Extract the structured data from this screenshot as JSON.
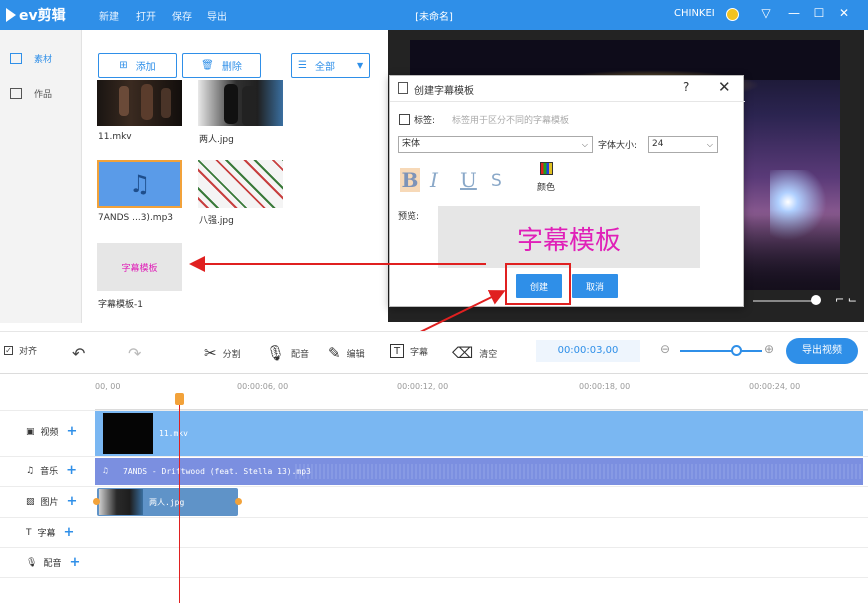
{
  "app": {
    "logo_text": "ev剪辑",
    "menu": [
      "新建",
      "打开",
      "保存",
      "导出"
    ],
    "window_title": "[未命名]",
    "username": "CHINKEI"
  },
  "leftnav": {
    "items": [
      {
        "label": "素材",
        "active": true
      },
      {
        "label": "作品",
        "active": false
      }
    ]
  },
  "materials": {
    "add_label": "添加",
    "delete_label": "删除",
    "filter_label": "全部",
    "items": [
      {
        "name": "11.mkv"
      },
      {
        "name": "两人.jpg"
      },
      {
        "name": "7ANDS ...3).mp3"
      },
      {
        "name": "八强.jpg"
      },
      {
        "name": "字幕模板-1",
        "thumb_text": "字幕模板"
      }
    ]
  },
  "dialog": {
    "title": "创建字幕模板",
    "help": "?",
    "close": "✕",
    "tag_label": "标签:",
    "tag_placeholder": "标签用于区分不同的字幕模板",
    "font_value": "宋体",
    "size_label": "字体大小:",
    "size_value": "24",
    "format_buttons": [
      "B",
      "I",
      "U",
      "S"
    ],
    "color_label": "颜色",
    "preview_label": "预览:",
    "preview_text": "字幕模板",
    "create_label": "创建",
    "cancel_label": "取消"
  },
  "toolbar": {
    "align_label": "对齐",
    "split_label": "分割",
    "dub_label": "配音",
    "edit_label": "编辑",
    "subtitle_label": "字幕",
    "clear_label": "清空",
    "timecode": "00:00:03,00",
    "export_label": "导出视频"
  },
  "timeline": {
    "ruler": [
      "00, 00",
      "00:00:06, 00",
      "00:00:12, 00",
      "00:00:18, 00",
      "00:00:24, 00"
    ],
    "tracks": [
      {
        "label": "视频",
        "icon": "video-icon"
      },
      {
        "label": "音乐",
        "icon": "music-icon"
      },
      {
        "label": "图片",
        "icon": "image-icon"
      },
      {
        "label": "字幕",
        "icon": "text-icon"
      },
      {
        "label": "配音",
        "icon": "mic-icon"
      }
    ],
    "clips": {
      "video": "11.mkv",
      "music": "7ANDS - Driftwood (feat. Stella 13).mp3",
      "image": "两人.jpg"
    }
  },
  "colors": {
    "accent": "#2f8fe8",
    "annotation": "#e02020",
    "preview_text": "#e020b8"
  }
}
